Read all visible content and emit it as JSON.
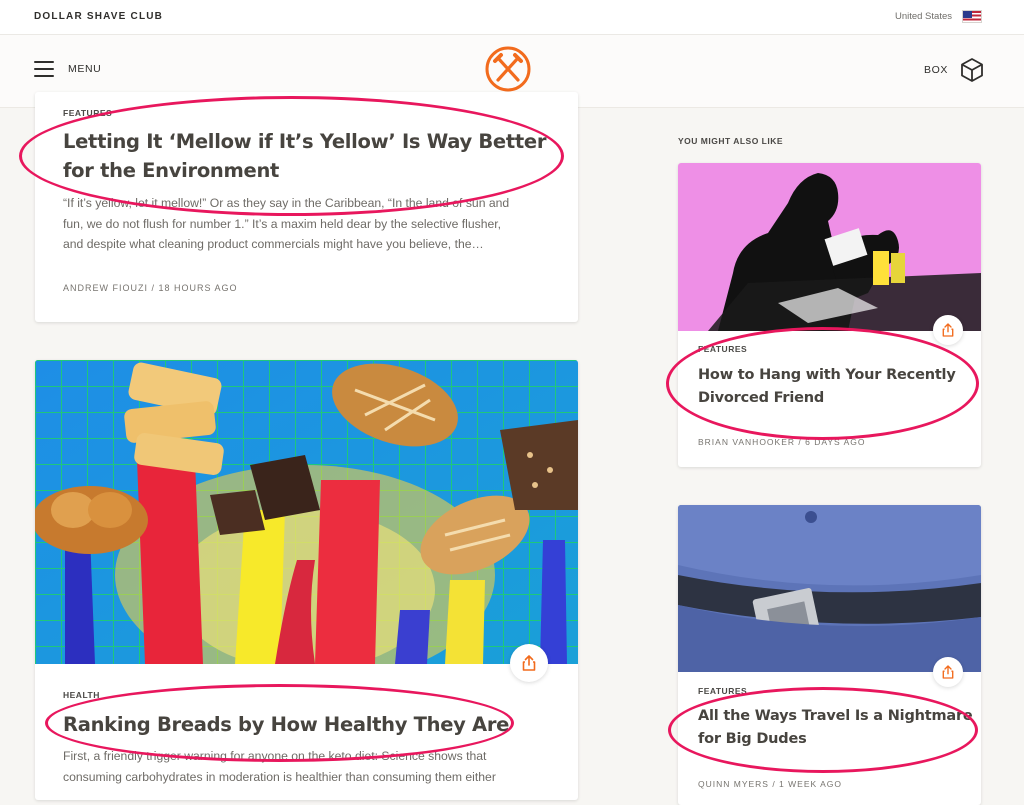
{
  "topbar": {
    "brand": "DOLLAR SHAVE CLUB",
    "country": "United States",
    "flag_icon": "us-flag-icon"
  },
  "nav": {
    "menu_label": "MENU",
    "box_label": "BOX",
    "logo_icon": "dsc-logo-icon",
    "brand_color": "#f26b1d"
  },
  "article1": {
    "category": "FEATURES",
    "title_line1": "Letting It ‘Mellow if It’s Yellow’ Is Way Better",
    "title_line2": "for the Environment",
    "excerpt_line1": "“If it’s yellow, let it mellow!” Or as they say in the Caribbean, “In the land of sun and",
    "excerpt_line2": "fun, we do not flush for number 1.” It’s a maxim held dear by the selective flusher,",
    "excerpt_line3": "and despite what cleaning product commercials might have you believe, the…",
    "byline": "ANDREW FIOUZI / 18 HOURS AGO"
  },
  "article2": {
    "category": "HEALTH",
    "title": "Ranking Breads by How Healthy They Are",
    "excerpt_line1": "First, a friendly trigger warning for anyone on the keto diet: Science shows that",
    "excerpt_line2": "consuming carbohydrates in moderation is healthier than consuming them either",
    "image_icon": "breads-illustration"
  },
  "sidebar": {
    "heading": "YOU MIGHT ALSO LIKE",
    "items": [
      {
        "category": "FEATURES",
        "title_line1": "How to Hang with Your Recently",
        "title_line2": "Divorced Friend",
        "byline": "BRIAN VANHOOKER / 6 DAYS AGO",
        "image_icon": "bar-scene-illustration"
      },
      {
        "category": "FEATURES",
        "title_line1": "All the Ways Travel Is a Nightmare",
        "title_line2": "for Big Dudes",
        "byline": "QUINN MYERS / 1 WEEK AGO",
        "image_icon": "seatbelt-photo"
      }
    ]
  },
  "colors": {
    "annotation": "#e8175d",
    "accent": "#f26b1d",
    "background": "#f7f6f3"
  }
}
